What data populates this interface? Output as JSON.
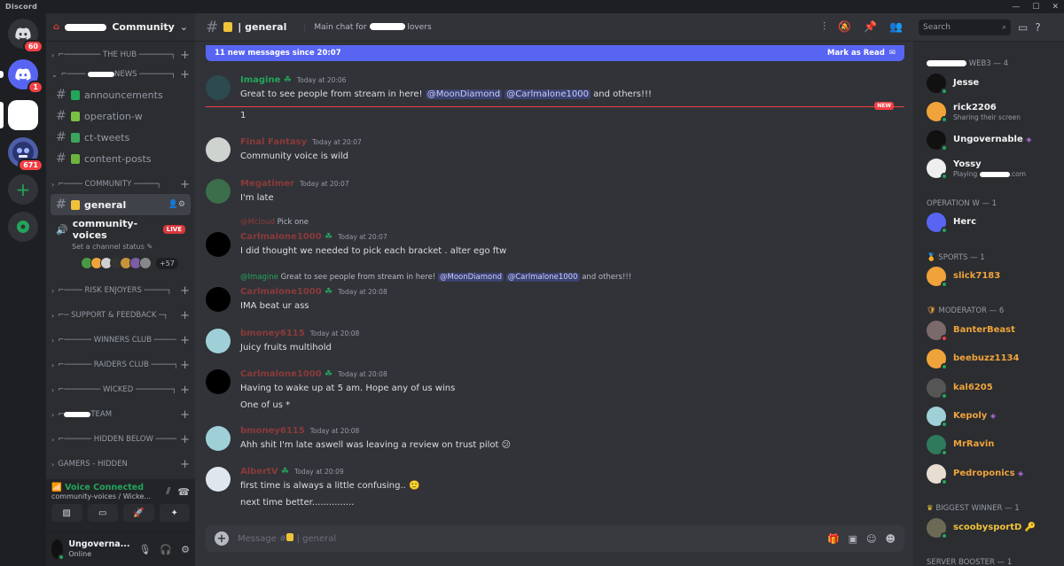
{
  "app_title": "Discord",
  "rail": {
    "badges": [
      "60",
      "1",
      "671"
    ]
  },
  "guild": {
    "name": "Community"
  },
  "categories": {
    "hub": "THE HUB",
    "news": "NEWS",
    "community": "COMMUNITY",
    "risk": "RISK ENJOYERS",
    "support": "SUPPORT & FEEDBACK",
    "winners": "WINNERS CLUB",
    "raiders": "RAIDERS CLUB",
    "wicked": "WICKED",
    "team": "TEAM",
    "hidden_below": "HIDDEN BELOW",
    "gamers": "GAMERS - HIDDEN"
  },
  "channels": {
    "announcements": "announcements",
    "operation": "operation-w",
    "tweets": "ct-tweets",
    "content": "content-posts",
    "general": "general"
  },
  "voice": {
    "channel": "community-voices",
    "live": "LIVE",
    "status": "Set a channel status",
    "more": "+57",
    "connected": "Voice Connected",
    "sub": "community-voices / Wicke..."
  },
  "user": {
    "name": "Ungoverna...",
    "status": "Online"
  },
  "chat": {
    "channel": "general",
    "topic_prefix": "Main chat for",
    "topic_suffix": "lovers",
    "new_messages": "11 new messages since 20:07",
    "mark_read": "Mark as Read",
    "new_tag": "NEW",
    "placeholder": "Message #",
    "placeholder_channel": "| general"
  },
  "messages": {
    "m1": {
      "user": "Imagine",
      "time": "Today at 20:06",
      "text": "Great to see people from stream in here!",
      "mention1": "@MoonDiamond",
      "mention2": "@Carlmalone1000",
      "tail": "and others!!!"
    },
    "m1b": "1",
    "m2": {
      "user": "Final Fantasy",
      "time": "Today at 20:07",
      "text": "Community voice is wild"
    },
    "m3": {
      "user": "Megatimer",
      "time": "Today at 20:07",
      "text": "I'm late"
    },
    "m4": {
      "reply_user": "@Mcloud",
      "reply_text": "Pick one",
      "user": "Carlmalone1000",
      "time": "Today at 20:07",
      "text": "I did thought we needed to pick each bracket . alter ego ftw"
    },
    "m5": {
      "reply_user": "@Imagine",
      "reply_text": "Great to see people from stream in here!",
      "reply_m1": "@MoonDiamond",
      "reply_m2": "@Carlmalone1000",
      "reply_tail": "and others!!!",
      "user": "Carlmalone1000",
      "time": "Today at 20:08",
      "text": "IMA beat ur ass"
    },
    "m6": {
      "user": "bmoney6115",
      "time": "Today at 20:08",
      "text": "Juicy fruits multihold"
    },
    "m7": {
      "user": "Carlmalone1000",
      "time": "Today at 20:08",
      "text": "Having to wake up at 5 am. Hope any of us wins",
      "text2": "One of us *"
    },
    "m8": {
      "user": "bmoney6115",
      "time": "Today at 20:08",
      "text": "Ahh shit I'm late aswell was leaving a review on trust pilot"
    },
    "m9": {
      "user": "AlbertV",
      "time": "Today at 20:09",
      "text": "first time is always a little confusing..",
      "text2": "next time better..............."
    }
  },
  "search": "Search",
  "members": {
    "g1": "WEB3 — 4",
    "jesse": "Jesse",
    "rick": "rick2206",
    "rick_status": "Sharing their screen",
    "ungov": "Ungovernable",
    "yossy": "Yossy",
    "yossy_status": "Playing",
    "yossy_com": ".com",
    "g2": "OPERATION W — 1",
    "herc": "Herc",
    "g3": "SPORTS — 1",
    "slick": "slick7183",
    "g4": "MODERATOR — 6",
    "banter": "BanterBeast",
    "beebuzz": "beebuzz1134",
    "kal": "kal6205",
    "kepoly": "Kepoly",
    "mrravin": "MrRavin",
    "pedro": "Pedroponics",
    "g5": "BIGGEST WINNER — 1",
    "scooby": "scoobysportD",
    "g6": "SERVER BOOSTER — 1"
  },
  "colors": {
    "accent": "#5865f2",
    "red_name": "#8b3a3a",
    "green": "#23a55a",
    "orange": "#f0a33a",
    "yellow": "#f0c23a"
  }
}
